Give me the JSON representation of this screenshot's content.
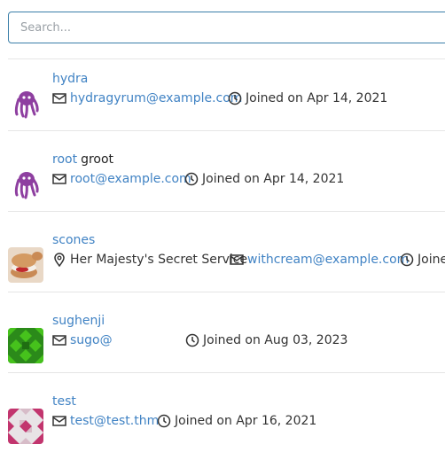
{
  "search": {
    "placeholder": "Search..."
  },
  "users": [
    {
      "username": "hydra",
      "full_name": "",
      "email": "hydragyrum@example.com",
      "joined": "Joined on Apr 14, 2021",
      "avatar_icon": "octopus-avatar-icon"
    },
    {
      "username": "root",
      "full_name": "groot",
      "email": "root@example.com",
      "joined": "Joined on Apr 14, 2021",
      "avatar_icon": "octopus-avatar-icon"
    },
    {
      "username": "scones",
      "full_name": "",
      "location": "Her Majesty's Secret Service",
      "email": "withcream@example.com",
      "joined": "Joine",
      "avatar_icon": "scone-photo-avatar"
    },
    {
      "username": "sughenji",
      "full_name": "",
      "email": "sugo@",
      "joined": "Joined on Aug 03, 2023",
      "avatar_icon": "green-identicon-avatar"
    },
    {
      "username": "test",
      "full_name": "",
      "email": "test@test.thm",
      "joined": "Joined on Apr 16, 2021",
      "avatar_icon": "pink-identicon-avatar"
    }
  ],
  "colors": {
    "link": "#4183c4",
    "search_border": "#3b7fa8",
    "divider": "#e5e5e5"
  }
}
